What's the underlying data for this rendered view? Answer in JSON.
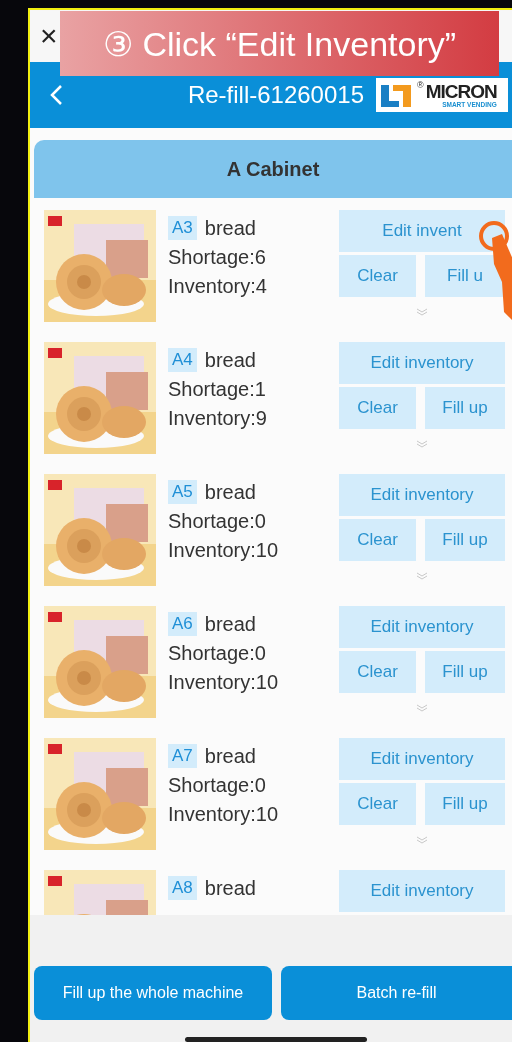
{
  "banner": {
    "text": "③ Click “Edit Inventory”"
  },
  "close": "×",
  "header": {
    "title": "Re-fill-61260015",
    "logo": {
      "mark": "®",
      "name": "MICRON",
      "tagline": "SMART VENDING"
    }
  },
  "cabinet": "A Cabinet",
  "slots": [
    {
      "code": "A3",
      "name": "bread",
      "shortage": "Shortage:6",
      "inventory": "Inventory:4",
      "edit": "Edit invent",
      "clear": "Clear",
      "fill": "Fill u",
      "pointer": true
    },
    {
      "code": "A4",
      "name": "bread",
      "shortage": "Shortage:1",
      "inventory": "Inventory:9",
      "edit": "Edit inventory",
      "clear": "Clear",
      "fill": "Fill up",
      "pointer": false
    },
    {
      "code": "A5",
      "name": "bread",
      "shortage": "Shortage:0",
      "inventory": "Inventory:10",
      "edit": "Edit inventory",
      "clear": "Clear",
      "fill": "Fill up",
      "pointer": false
    },
    {
      "code": "A6",
      "name": "bread",
      "shortage": "Shortage:0",
      "inventory": "Inventory:10",
      "edit": "Edit inventory",
      "clear": "Clear",
      "fill": "Fill up",
      "pointer": false
    },
    {
      "code": "A7",
      "name": "bread",
      "shortage": "Shortage:0",
      "inventory": "Inventory:10",
      "edit": "Edit inventory",
      "clear": "Clear",
      "fill": "Fill up",
      "pointer": false
    },
    {
      "code": "A8",
      "name": "bread",
      "edit": "Edit inventory",
      "pointer": false
    }
  ],
  "actions": [
    "Fill up the whole machine",
    "Batch re-fill"
  ]
}
